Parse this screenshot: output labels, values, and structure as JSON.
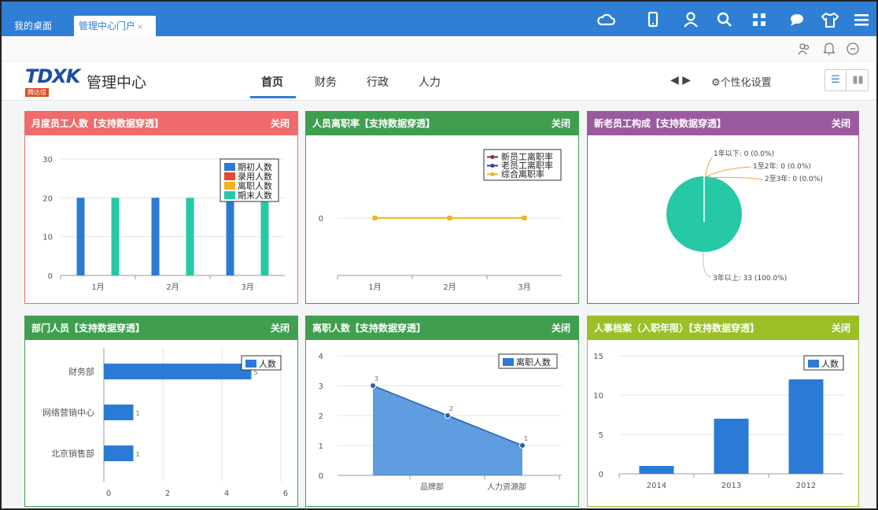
{
  "tabs": {
    "desktop": "我的桌面",
    "portal": "管理中心门户",
    "close": "×"
  },
  "header": {
    "logo_text": "TDXK",
    "logo_sub": "腾达信科",
    "app_title": "管理中心",
    "nav": [
      "首页",
      "财务",
      "行政",
      "人力"
    ],
    "active_nav": "首页",
    "settings_label": "个性化设置"
  },
  "colors": {
    "topbar": "#2f7fd4",
    "red": "#f06b6b",
    "green": "#3f9f4f",
    "purple": "#9b5aa0",
    "lime": "#9cbf28",
    "bar_blue": "#2b7bd6",
    "teal": "#25c9a6"
  },
  "panels": {
    "p1": {
      "title": "月度员工人数【支持数据穿透】",
      "close": "关闭"
    },
    "p2": {
      "title": "人员离职率【支持数据穿透】",
      "close": "关闭"
    },
    "p3": {
      "title": "新老员工构成【支持数据穿透】",
      "close": "关闭"
    },
    "p4": {
      "title": "部门人员【支持数据穿透】",
      "close": "关闭"
    },
    "p5": {
      "title": "离职人数【支持数据穿透】",
      "close": "关闭"
    },
    "p6": {
      "title": "人事档案（入职年限）【支持数据穿透】",
      "close": "关闭"
    }
  },
  "chart_data": [
    {
      "type": "bar",
      "categories": [
        "1月",
        "2月",
        "3月"
      ],
      "series": [
        {
          "name": "期初人数",
          "values": [
            20,
            20,
            20
          ],
          "color": "#2b7bd6"
        },
        {
          "name": "录用人数",
          "values": [
            0,
            0,
            0
          ],
          "color": "#e8492d"
        },
        {
          "name": "离职人数",
          "values": [
            0,
            0,
            0
          ],
          "color": "#f2b51c"
        },
        {
          "name": "期末人数",
          "values": [
            20,
            20,
            20
          ],
          "color": "#25c9a6"
        }
      ],
      "yticks": [
        0,
        10,
        20,
        30
      ],
      "ylim": [
        0,
        30
      ],
      "legend": "top-right"
    },
    {
      "type": "line",
      "categories": [
        "1月",
        "2月",
        "3月"
      ],
      "series": [
        {
          "name": "新员工离职率",
          "values": [
            0,
            0,
            0
          ],
          "color": "#8a2a3a"
        },
        {
          "name": "老员工离职率",
          "values": [
            0,
            0,
            0
          ],
          "color": "#3a3aa0"
        },
        {
          "name": "综合离职率",
          "values": [
            0,
            0,
            0
          ],
          "color": "#f2b51c"
        }
      ],
      "yticks": [
        0
      ],
      "legend": "top-right"
    },
    {
      "type": "pie",
      "slices": [
        {
          "label": "1年以下",
          "value": 0,
          "text": "1年以下: 0 (0.0%)"
        },
        {
          "label": "1至2年",
          "value": 0,
          "text": "1至2年: 0 (0.0%)"
        },
        {
          "label": "2至3年",
          "value": 0,
          "text": "2至3年: 0 (0.0%)"
        },
        {
          "label": "3年以上",
          "value": 33,
          "text": "3年以上: 33 (100.0%)"
        }
      ],
      "color": "#25c9a6"
    },
    {
      "type": "bar",
      "orientation": "horizontal",
      "categories": [
        "财务部",
        "网络营销中心",
        "北京销售部"
      ],
      "series": [
        {
          "name": "人数",
          "values": [
            5,
            1,
            1
          ],
          "color": "#2b7bd6"
        }
      ],
      "xticks": [
        0,
        2,
        4,
        6
      ],
      "xlim": [
        0,
        6
      ],
      "legend": "top-right"
    },
    {
      "type": "area",
      "categories": [
        "",
        "品牌部",
        "人力资源部"
      ],
      "series": [
        {
          "name": "离职人数",
          "values": [
            3,
            2,
            1
          ],
          "color": "#2b7bd6"
        }
      ],
      "yticks": [
        0,
        1,
        2,
        3,
        4
      ],
      "ylim": [
        0,
        4
      ],
      "legend": "top-right"
    },
    {
      "type": "bar",
      "categories": [
        "2014",
        "2013",
        "2012"
      ],
      "series": [
        {
          "name": "人数",
          "values": [
            1,
            7,
            12
          ],
          "color": "#2b7bd6"
        }
      ],
      "yticks": [
        0,
        5,
        10,
        15
      ],
      "ylim": [
        0,
        15
      ],
      "legend": "top-right"
    }
  ]
}
